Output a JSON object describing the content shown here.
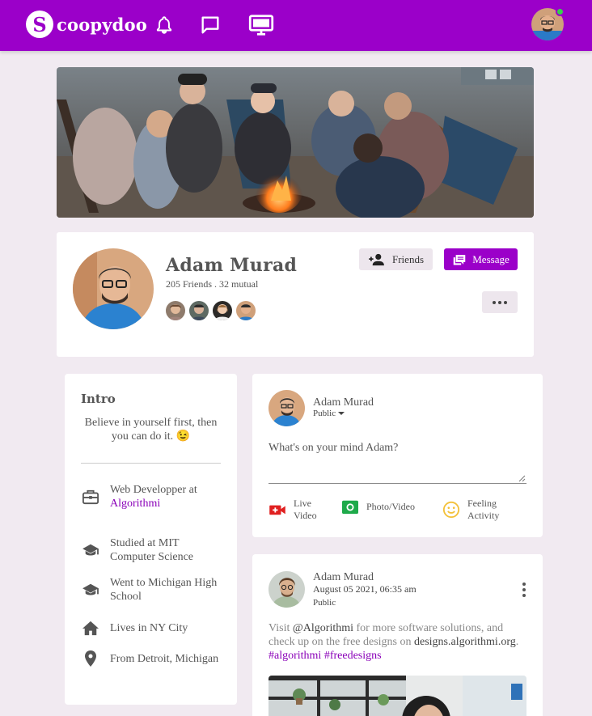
{
  "header": {
    "logo_letter": "S",
    "logo_text": "coopydoo",
    "nav_icons": [
      "bell-icon",
      "chat-icon",
      "monitor-icon"
    ],
    "brand_color": "#9b00c9",
    "online_color": "#37d24b"
  },
  "profile": {
    "name": "Adam Murad",
    "friends_line": "205 Friends . 32 mutual",
    "friends_button": "Friends",
    "message_button": "Message"
  },
  "intro": {
    "title": "Intro",
    "bio": "Believe in yourself first, then you can do it. 😉",
    "items": [
      {
        "icon": "briefcase-icon",
        "text": "Web Developper at ",
        "link": "Algorithmi"
      },
      {
        "icon": "graduation-cap-icon",
        "text": "Studied at MIT Computer Science"
      },
      {
        "icon": "graduation-cap-icon",
        "text": "Went to Michigan High School"
      },
      {
        "icon": "home-icon",
        "text": "Lives in NY City"
      },
      {
        "icon": "location-pin-icon",
        "text": "From Detroit, Michigan"
      }
    ]
  },
  "composer": {
    "name": "Adam Murad",
    "privacy": "Public",
    "placeholder": "What's on your mind Adam?",
    "actions": [
      {
        "icon": "live-video-icon",
        "label": "Live Video"
      },
      {
        "icon": "photo-icon",
        "label": "Photo/Video"
      },
      {
        "icon": "smiley-icon",
        "label": "Feeling Activity"
      }
    ]
  },
  "post": {
    "name": "Adam Murad",
    "date": "August 05 2021, 06:35 am",
    "privacy": "Public",
    "text_visit": "Visit ",
    "text_mention": "@Algorithmi",
    "text_middle": " for more software solutions, and check up on the free designs on ",
    "text_site": "designs.algorithmi.org",
    "text_dot": ". ",
    "tag_1": "#algorithmi",
    "tag_2": "#freedesigns"
  }
}
